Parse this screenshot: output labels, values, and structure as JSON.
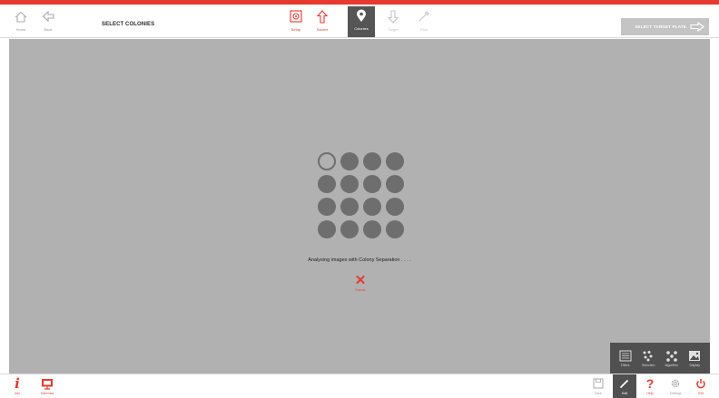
{
  "colors": {
    "accent": "#e63a2e",
    "work_area": "#b1b1b1",
    "panel": "#505050",
    "dot": "#6e6e6e"
  },
  "header": {
    "title": "SELECT COLONIES",
    "nav_left": [
      {
        "label": "Home",
        "icon": "home-icon"
      },
      {
        "label": "Back",
        "icon": "back-arrow-icon"
      }
    ],
    "steps": [
      {
        "label": "Setup",
        "icon": "setup-icon",
        "state": "done"
      },
      {
        "label": "Source",
        "icon": "upload-arrow-icon",
        "state": "done"
      },
      {
        "label": "Colonies",
        "icon": "location-pin-icon",
        "state": "active"
      },
      {
        "label": "Target",
        "icon": "download-arrow-icon",
        "state": "pending"
      },
      {
        "label": "Pick",
        "icon": "pipette-icon",
        "state": "pending"
      }
    ],
    "next_button": "SELECT TARGET PLATE"
  },
  "progress": {
    "message": "Analysing images with Colony Separation . . . .",
    "cancel_label": "Cancel"
  },
  "tools": [
    {
      "label": "Filters",
      "icon": "filters-icon"
    },
    {
      "label": "Selection",
      "icon": "selection-icon"
    },
    {
      "label": "Algorithm",
      "icon": "algorithm-icon"
    },
    {
      "label": "Display",
      "icon": "image-icon"
    }
  ],
  "footer": {
    "left": [
      {
        "label": "Info",
        "icon": "info-icon"
      },
      {
        "label": "Overview",
        "icon": "monitor-icon"
      }
    ],
    "right": [
      {
        "label": "Save",
        "icon": "save-icon"
      },
      {
        "label": "Edit",
        "icon": "pencil-icon"
      },
      {
        "label": "Help",
        "icon": "help-icon"
      },
      {
        "label": "Settings",
        "icon": "settings-icon"
      },
      {
        "label": "Exit",
        "icon": "power-icon"
      }
    ]
  }
}
